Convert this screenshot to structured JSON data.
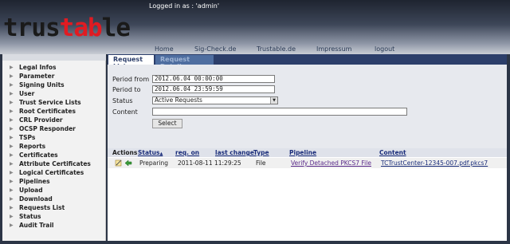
{
  "header": {
    "login_text": "Logged in as : 'admin'",
    "logo_part1": "trus",
    "logo_part2": "tab",
    "logo_part3": "le",
    "nav": [
      "Home",
      "Sig-Check.de",
      "Trustable.de",
      "Impressum",
      "logout"
    ]
  },
  "sidebar": {
    "items": [
      "Legal Infos",
      "Parameter",
      "Signing Units",
      "User",
      "Trust Service Lists",
      "Root Certificates",
      "CRL Provider",
      "OCSP Responder",
      "TSPs",
      "Reports",
      "Certificates",
      "Attribute Certificates",
      "Logical Certificates",
      "Pipelines",
      "Upload",
      "Download",
      "Requests List",
      "Status",
      "Audit Trail"
    ]
  },
  "tabs": {
    "active": "Request List",
    "inactive": "Request Details"
  },
  "form": {
    "period_from_label": "Period from",
    "period_from_value": "2012.06.04 00:00:00",
    "period_to_label": "Period to",
    "period_to_value": "2012.06.04 23:59:59",
    "status_label": "Status",
    "status_value": "Active Requests",
    "content_label": "Content",
    "content_value": "",
    "select_button": "Select"
  },
  "table": {
    "headers": {
      "actions": "Actions",
      "status": "Status",
      "status_sort": "▲",
      "req_on": "req. on",
      "last_change": "last change",
      "type": "Type",
      "pipeline": "Pipeline",
      "content": "Content"
    },
    "rows": [
      {
        "status": "Preparing",
        "date": "2011-08-11 11:29:25",
        "type": "File",
        "pipeline": "Verify Detached PKCS7 File",
        "content": "TCTrustCenter-12345-007.pdf.pkcs7"
      }
    ]
  },
  "colors": {
    "brand_red": "#e11b22",
    "nav_dark": "#2c3e6a"
  },
  "icons": [
    "edit-icon",
    "back-arrow-icon",
    "triangle-right-icon",
    "dropdown-arrow-icon"
  ]
}
